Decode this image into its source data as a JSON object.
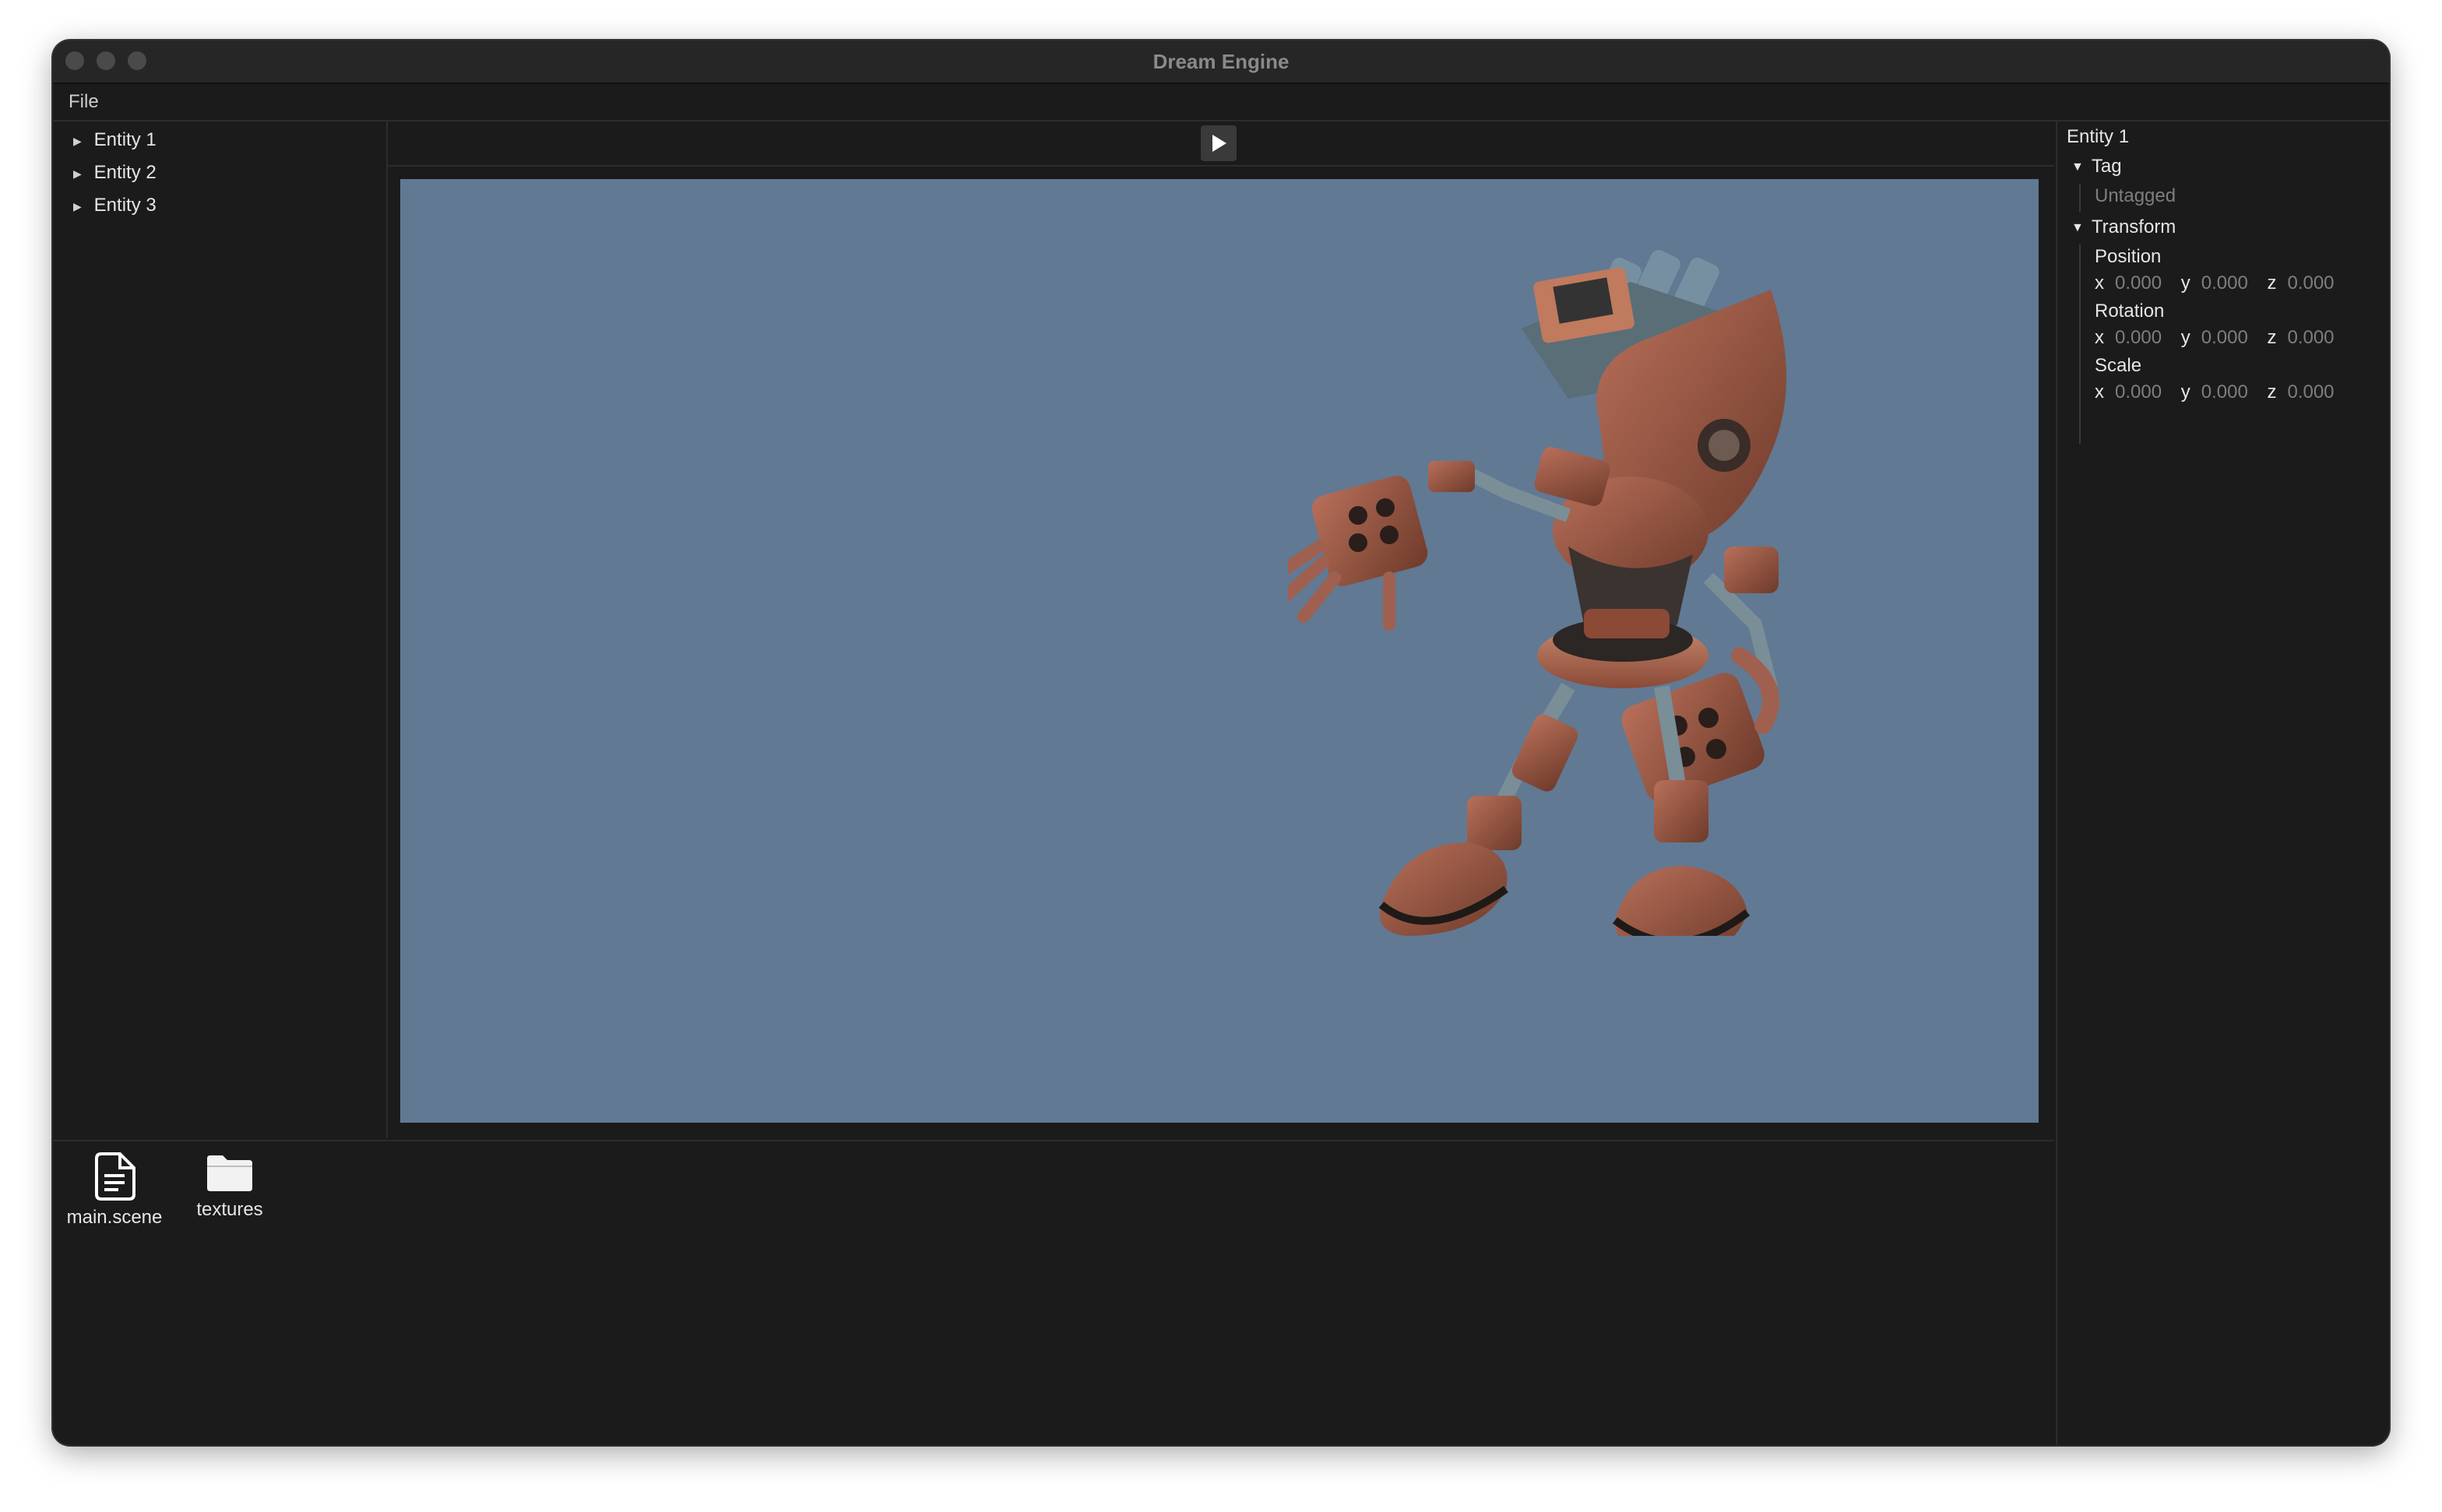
{
  "window": {
    "title": "Dream Engine"
  },
  "menu": {
    "file": "File"
  },
  "hierarchy": {
    "items": [
      {
        "label": "Entity 1"
      },
      {
        "label": "Entity 2"
      },
      {
        "label": "Entity 3"
      }
    ]
  },
  "toolbar": {
    "play_icon": "play-icon"
  },
  "viewport": {
    "background": "#617993",
    "content": "robot-model"
  },
  "inspector": {
    "entity_name": "Entity 1",
    "tag_header": "Tag",
    "tag_value": "Untagged",
    "transform_header": "Transform",
    "position_label": "Position",
    "rotation_label": "Rotation",
    "scale_label": "Scale",
    "axis_x": "x",
    "axis_y": "y",
    "axis_z": "z",
    "position": {
      "x": "0.000",
      "y": "0.000",
      "z": "0.000"
    },
    "rotation": {
      "x": "0.000",
      "y": "0.000",
      "z": "0.000"
    },
    "scale": {
      "x": "0.000",
      "y": "0.000",
      "z": "0.000"
    }
  },
  "assets": {
    "items": [
      {
        "label": "main.scene",
        "icon": "document-icon"
      },
      {
        "label": "textures",
        "icon": "folder-icon"
      }
    ]
  }
}
